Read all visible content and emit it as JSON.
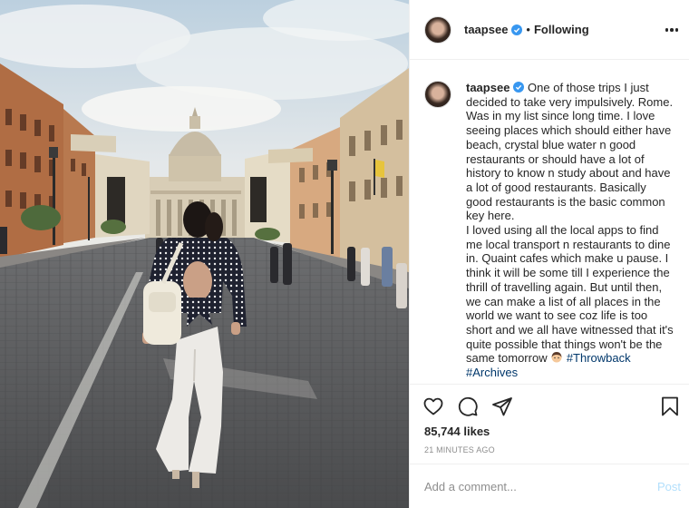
{
  "post": {
    "username": "taapsee",
    "follow_status": "Following",
    "separator": "•",
    "caption": " One of those trips I just decided to take very impulsively. Rome. Was in my list since long time. I love seeing places which should either have beach, crystal blue water n good restaurants or should have a lot of history to know n study about and have a lot of good restaurants. Basically good restaurants is the basic common key here.\nI loved using all the local apps to find me local transport n restaurants to dine in. Quaint cafes which make u pause. I think it will be some till I experience the thrill of travelling again. But until then, we can make a list of all places in the world we want to see coz life is too short and we all have witnessed that it's quite possible that things won't be the same tomorrow ",
    "hashtags": [
      " #Throwback",
      " #Archives"
    ],
    "likes": "85,744 likes",
    "timestamp": "21 MINUTES AGO"
  },
  "comment": {
    "placeholder": "Add a comment...",
    "post_label": "Post"
  },
  "icons": {
    "verified": "verified-badge-icon",
    "more": "more-options-icon",
    "like": "heart-icon",
    "comment": "comment-icon",
    "share": "paper-plane-icon",
    "save": "bookmark-icon",
    "emoji": "woman-emoji-icon"
  },
  "colors": {
    "verified_blue": "#3897f0",
    "hashtag": "#00376b",
    "post_disabled": "#b2dffc",
    "muted": "#8e8e8e"
  }
}
